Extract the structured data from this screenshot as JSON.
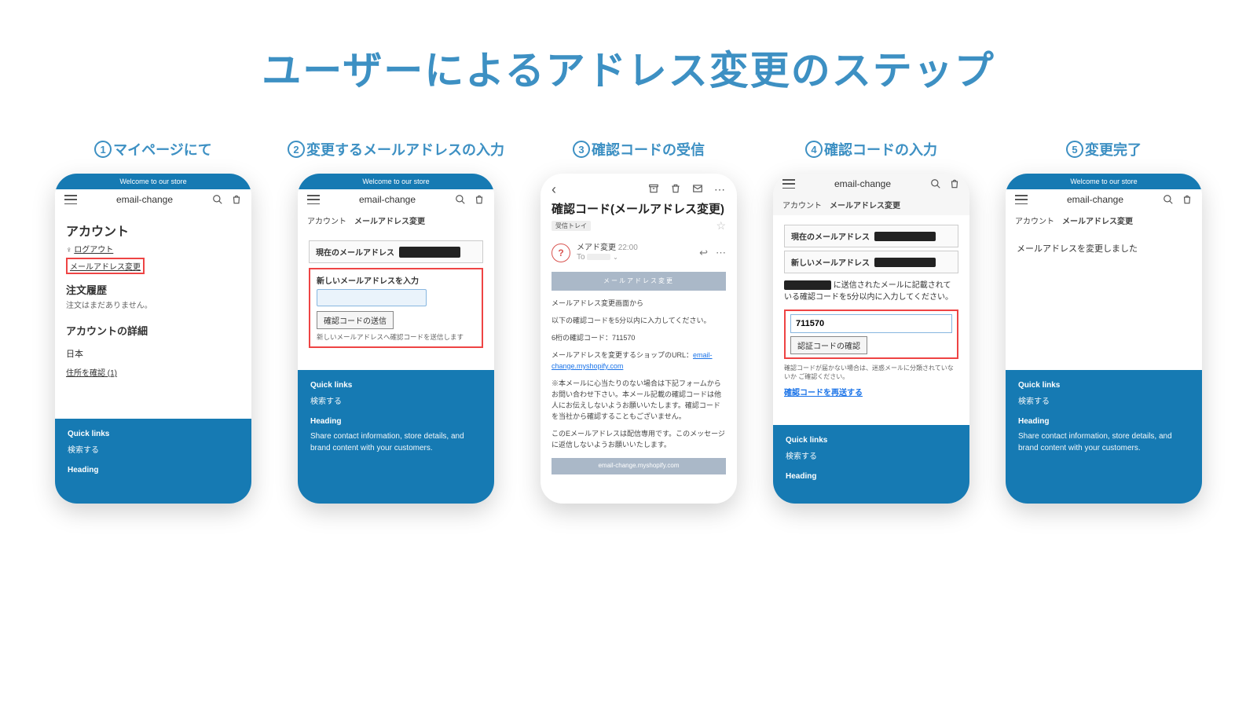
{
  "title": "ユーザーによるアドレス変更のステップ",
  "steps": [
    "マイページにて",
    "変更するメールアドレスの入力",
    "確認コードの受信",
    "確認コードの入力",
    "変更完了"
  ],
  "nums": [
    "1",
    "2",
    "3",
    "4",
    "5"
  ],
  "common": {
    "banner": "Welcome to our store",
    "brand": "email-change",
    "crumb_account": "アカウント",
    "crumb_change": "メールアドレス変更",
    "quick_links": "Quick links",
    "search": "検索する",
    "heading": "Heading",
    "footer_text": "Share contact information, store details, and brand content with your customers."
  },
  "s1": {
    "h1": "アカウント",
    "logout": "ログアウト",
    "link": "メールアドレス変更",
    "orders_h": "注文履歴",
    "orders_none": "注文はまだありません。",
    "detail_h": "アカウントの詳細",
    "country": "日本",
    "addr": "住所を確認 (1)"
  },
  "s2": {
    "current": "現在のメールアドレス",
    "new_label": "新しいメールアドレスを入力",
    "btn": "確認コードの送信",
    "hint": "新しいメールアドレスへ確認コードを送信します"
  },
  "s3": {
    "subject": "確認コード(メールアドレス変更)",
    "inbox": "受信トレイ",
    "from": "メアド変更",
    "time": "22:00",
    "to_label": "To",
    "mail_head": "メールアドレス変更",
    "l1": "メールアドレス変更画面から",
    "l2": "以下の確認コードを5分以内に入力してください。",
    "l3": "6桁の確認コード：711570",
    "l4a": "メールアドレスを変更するショップのURL：",
    "l4b": "email-change.myshopify.com",
    "l5": "※本メールに心当たりのない場合は下記フォームからお問い合わせ下さい。本メール記載の確認コードは他人にお伝えしないようお願いいたします。確認コードを当社から確認することもございません。",
    "l6": "このEメールアドレスは配信専用です。このメッセージに返信しないようお願いいたします。",
    "foot": "email-change.myshopify.com"
  },
  "s4": {
    "current": "現在のメールアドレス",
    "new": "新しいメールアドレス",
    "para": "に送信されたメールに記載されている確認コードを5分以内に入力してください。",
    "code": "711570",
    "btn": "認証コードの確認",
    "tiny": "確認コードが届かない場合は、迷惑メールに分類されていないか ご確認ください。",
    "resend": "確認コードを再送する"
  },
  "s5": {
    "done": "メールアドレスを変更しました"
  }
}
